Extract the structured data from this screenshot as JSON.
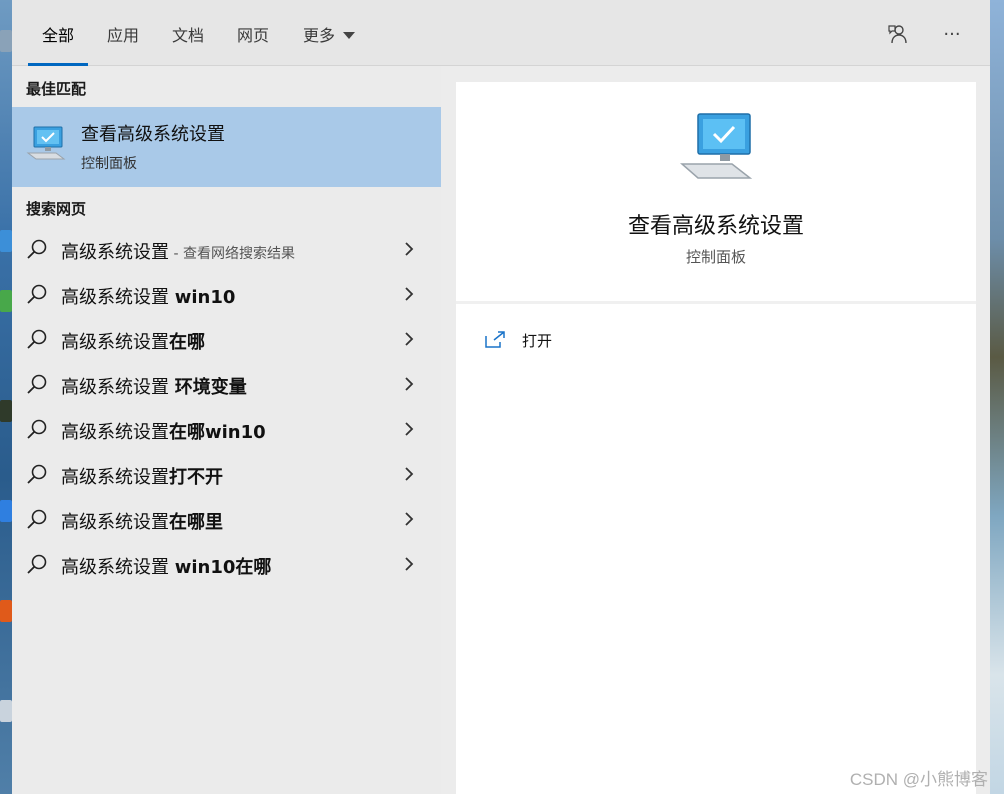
{
  "tabs": [
    {
      "label": "全部",
      "active": true
    },
    {
      "label": "应用"
    },
    {
      "label": "文档"
    },
    {
      "label": "网页"
    },
    {
      "label": "更多"
    }
  ],
  "top_icons": {
    "feedback": "feedback-person-icon",
    "more": "···"
  },
  "best_match": {
    "section_title": "最佳匹配",
    "title": "查看高级系统设置",
    "subtitle": "控制面板"
  },
  "web_search": {
    "section_title": "搜索网页",
    "items": [
      {
        "base": "高级系统设置",
        "bold": "",
        "hint": " - 查看网络搜索结果"
      },
      {
        "base": "高级系统设置 ",
        "bold": "win10",
        "hint": ""
      },
      {
        "base": "高级系统设置",
        "bold": "在哪",
        "hint": ""
      },
      {
        "base": "高级系统设置 ",
        "bold": "环境变量",
        "hint": ""
      },
      {
        "base": "高级系统设置",
        "bold": "在哪win10",
        "hint": ""
      },
      {
        "base": "高级系统设置",
        "bold": "打不开",
        "hint": ""
      },
      {
        "base": "高级系统设置",
        "bold": "在哪里",
        "hint": ""
      },
      {
        "base": "高级系统设置 ",
        "bold": "win10在哪",
        "hint": ""
      }
    ]
  },
  "detail": {
    "title": "查看高级系统设置",
    "subtitle": "控制面板",
    "open_label": "打开"
  },
  "watermark": "CSDN @小熊博客",
  "colors": {
    "accent": "#0067c0",
    "selected": "#a9c9e8"
  }
}
